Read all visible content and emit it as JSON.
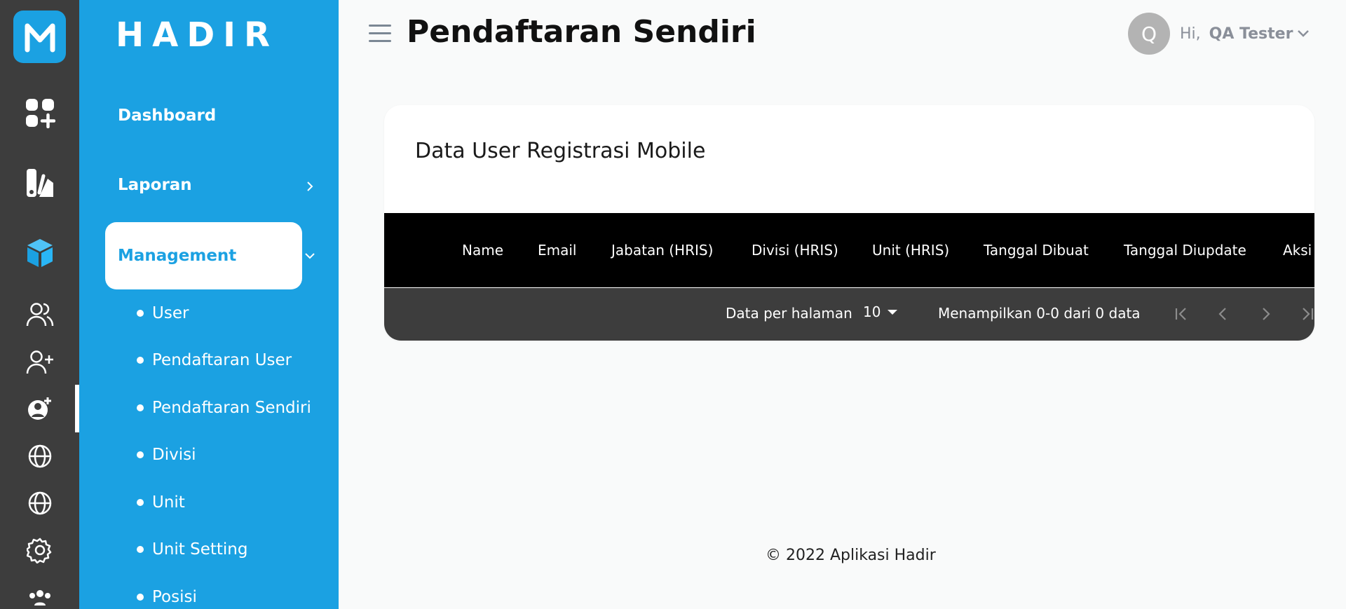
{
  "brand": {
    "name": "HADIR"
  },
  "header": {
    "title": "Pendaftaran Sendiri",
    "greeting": "Hi,",
    "user_name": "QA Tester",
    "avatar_initial": "Q"
  },
  "menu": {
    "dashboard": "Dashboard",
    "laporan": "Laporan",
    "management": "Management",
    "sub_items": [
      "User",
      "Pendaftaran User",
      "Pendaftaran Sendiri",
      "Divisi",
      "Unit",
      "Unit Setting",
      "Posisi"
    ]
  },
  "rail_icons": [
    "apps-add-icon",
    "report-icon",
    "cube-icon",
    "users-icon",
    "user-add-icon",
    "user-settings-icon",
    "globe-icon",
    "globe-icon-2",
    "gear-icon",
    "team-icon"
  ],
  "card": {
    "title": "Data User Registrasi Mobile",
    "columns": [
      "Name",
      "Email",
      "Jabatan (HRIS)",
      "Divisi (HRIS)",
      "Unit (HRIS)",
      "Tanggal Dibuat",
      "Tanggal Diupdate",
      "Aksi"
    ],
    "rows": [],
    "per_page_label": "Data per halaman",
    "per_page_value": "10",
    "showing_text": "Menampilkan 0-0 dari 0 data"
  },
  "footer": {
    "text": "© 2022 Aplikasi Hadir"
  },
  "colors": {
    "primary": "#1ba1e2",
    "rail": "#3d3d3d",
    "table_header": "#000000",
    "table_footer": "#3d3d3d"
  }
}
